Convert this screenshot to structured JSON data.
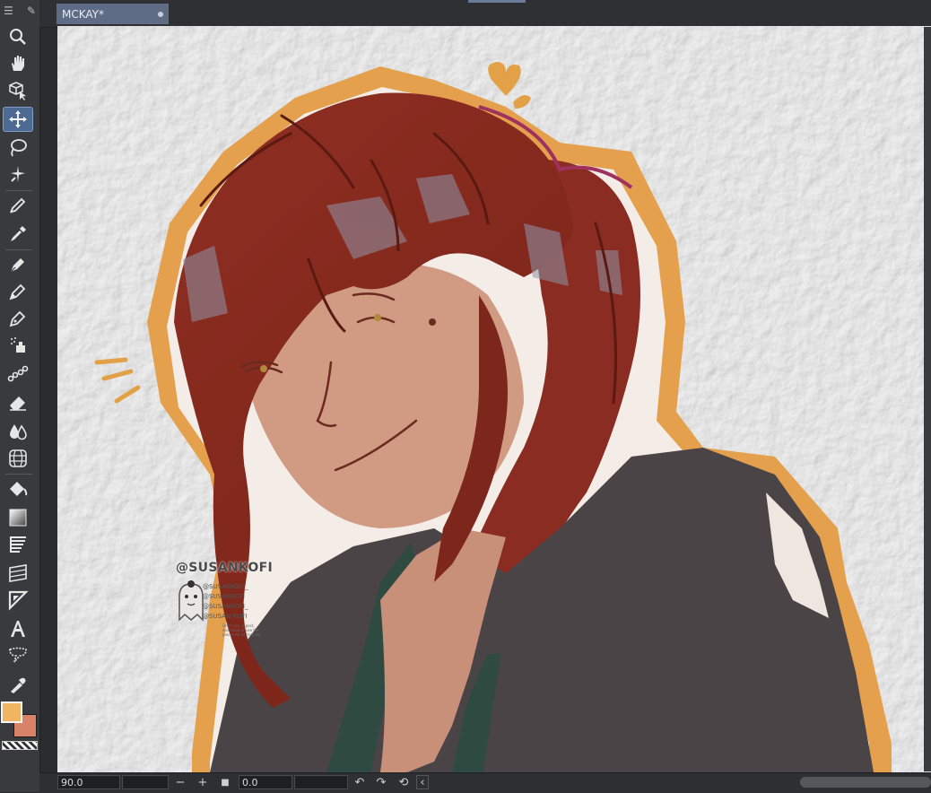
{
  "document": {
    "tab_title": "MCKAY*"
  },
  "toolbar": {
    "tools": [
      {
        "name": "zoom-tool",
        "icon": "magnifier-icon"
      },
      {
        "name": "hand-tool",
        "icon": "hand-icon"
      },
      {
        "name": "object-tool",
        "icon": "cube-pointer-icon"
      },
      {
        "name": "move-layer-tool",
        "icon": "move-arrows-icon",
        "active": true
      },
      {
        "name": "lasso-tool",
        "icon": "lasso-icon"
      },
      {
        "name": "magic-wand-tool",
        "icon": "magic-wand-icon"
      },
      {
        "name": "correct-line-tool",
        "icon": "pencil-outline-icon"
      },
      {
        "name": "eyedropper-tool",
        "icon": "eyedropper-icon"
      },
      {
        "name": "pen-tool",
        "icon": "pen-nib-icon"
      },
      {
        "name": "pencil-tool",
        "icon": "pencil-nib-icon"
      },
      {
        "name": "brush-tool",
        "icon": "brush-nib-icon"
      },
      {
        "name": "airbrush-tool",
        "icon": "airbrush-icon"
      },
      {
        "name": "decoration-tool",
        "icon": "decoration-chain-icon"
      },
      {
        "name": "eraser-tool",
        "icon": "eraser-icon"
      },
      {
        "name": "blend-tool",
        "icon": "water-drops-icon"
      },
      {
        "name": "figure-tool",
        "icon": "grid-sphere-icon"
      },
      {
        "name": "fill-tool",
        "icon": "paint-bucket-icon"
      },
      {
        "name": "gradient-tool",
        "icon": "gradient-square-icon"
      },
      {
        "name": "frame-tool",
        "icon": "frame-lines-icon"
      },
      {
        "name": "ruler-tool",
        "icon": "ruler-grid-icon"
      },
      {
        "name": "balloon-tool",
        "icon": "triangle-ruler-icon"
      },
      {
        "name": "text-tool",
        "icon": "text-a-icon"
      },
      {
        "name": "speech-balloon-tool",
        "icon": "speech-balloon-icon"
      },
      {
        "name": "line-tool",
        "icon": "line-pen-icon"
      }
    ],
    "main_color": "#f1b460",
    "sub_color": "#d9826a"
  },
  "watermark": {
    "main": "@SUSANKOFI",
    "handles": [
      "@SUSANKOFI_",
      "@SUSANKOFI",
      "@SUSANKOFI_",
      "@SUSAN-KOFI"
    ],
    "note": "Don't use, repost, download or use the pieces for AI training"
  },
  "statusbar": {
    "zoom": "90.0",
    "rotation": "0.0",
    "minus": "−",
    "plus": "+",
    "square": "■",
    "undo": "↶",
    "redo": "↷",
    "reset": "⟲",
    "left": "‹"
  },
  "colors": {
    "hair": "#8e2f22",
    "skin": "#cf9a80",
    "outline": "#e0a24e",
    "hoodie": "#4c4547",
    "collar": "#2f4a40"
  }
}
